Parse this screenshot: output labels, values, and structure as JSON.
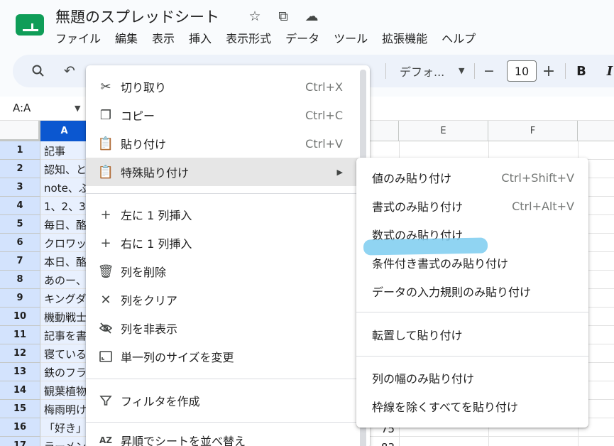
{
  "app": {
    "doc_title": "無題のスプレッドシート",
    "title_icons": [
      "star-icon",
      "move-to-folder-icon",
      "cloud-status-icon"
    ]
  },
  "menubar": [
    "ファイル",
    "編集",
    "表示",
    "挿入",
    "表示形式",
    "データ",
    "ツール",
    "拡張機能",
    "ヘルプ"
  ],
  "toolbar": {
    "icons": [
      "search-icon",
      "undo-icon"
    ],
    "font_name": "デフォ...",
    "font_size": "10",
    "font_size_minus": "−",
    "font_size_plus": "+",
    "bold": "B",
    "italic": "I"
  },
  "namebox": {
    "value": "A:A"
  },
  "columns": {
    "selected": "A",
    "visible": [
      "A",
      "E",
      "F"
    ]
  },
  "rows": [
    {
      "num": "1",
      "a": "記事"
    },
    {
      "num": "2",
      "a": "認知、と"
    },
    {
      "num": "3",
      "a": "note、ふ"
    },
    {
      "num": "4",
      "a": "1、2、3"
    },
    {
      "num": "5",
      "a": "毎日、酪"
    },
    {
      "num": "6",
      "a": "クロワッ"
    },
    {
      "num": "7",
      "a": "本日、酪"
    },
    {
      "num": "8",
      "a": "あのー、"
    },
    {
      "num": "9",
      "a": "キングダ"
    },
    {
      "num": "10",
      "a": "機動戦士"
    },
    {
      "num": "11",
      "a": "記事を書"
    },
    {
      "num": "12",
      "a": "寝ている"
    },
    {
      "num": "13",
      "a": "鉄のフラ"
    },
    {
      "num": "14",
      "a": "観葉植物"
    },
    {
      "num": "15",
      "a": "梅雨明け"
    },
    {
      "num": "16",
      "a": "「好き」"
    },
    {
      "num": "17",
      "a": "ラーメン"
    }
  ],
  "column_d_values": [
    {
      "row": "16",
      "value": "75"
    },
    {
      "row": "17",
      "value": "83"
    }
  ],
  "context_menu": {
    "items": [
      {
        "icon": "scissors-icon",
        "label": "切り取り",
        "shortcut": "Ctrl+X"
      },
      {
        "icon": "copy-icon",
        "label": "コピー",
        "shortcut": "Ctrl+C"
      },
      {
        "icon": "paste-icon",
        "label": "貼り付け",
        "shortcut": "Ctrl+V"
      },
      {
        "icon": "paste-special-icon",
        "label": "特殊貼り付け",
        "submenu": true
      },
      {
        "icon": "plus-icon",
        "label": "左に 1 列挿入"
      },
      {
        "icon": "plus-icon",
        "label": "右に 1 列挿入"
      },
      {
        "icon": "trash-icon",
        "label": "列を削除"
      },
      {
        "icon": "close-icon",
        "label": "列をクリア"
      },
      {
        "icon": "eye-off-icon",
        "label": "列を非表示"
      },
      {
        "icon": "resize-icon",
        "label": "単一列のサイズを変更"
      },
      {
        "icon": "filter-icon",
        "label": "フィルタを作成"
      },
      {
        "icon": "sort-az-icon",
        "label": "昇順でシートを並べ替え"
      }
    ]
  },
  "paste_special_submenu": {
    "items": [
      {
        "label": "値のみ貼り付け",
        "shortcut": "Ctrl+Shift+V"
      },
      {
        "label": "書式のみ貼り付け",
        "shortcut": "Ctrl+Alt+V"
      },
      {
        "label": "数式のみ貼り付け"
      },
      {
        "label": "条件付き書式のみ貼り付け"
      },
      {
        "label": "データの入力規則のみ貼り付け"
      },
      {
        "label": "転置して貼り付け"
      },
      {
        "label": "列の幅のみ貼り付け"
      },
      {
        "label": "枠線を除くすべてを貼り付け"
      }
    ]
  },
  "colors": {
    "accent": "#0b57d0",
    "highlight_mark": "#7dcdf0",
    "logo_green": "#0f9d58"
  }
}
